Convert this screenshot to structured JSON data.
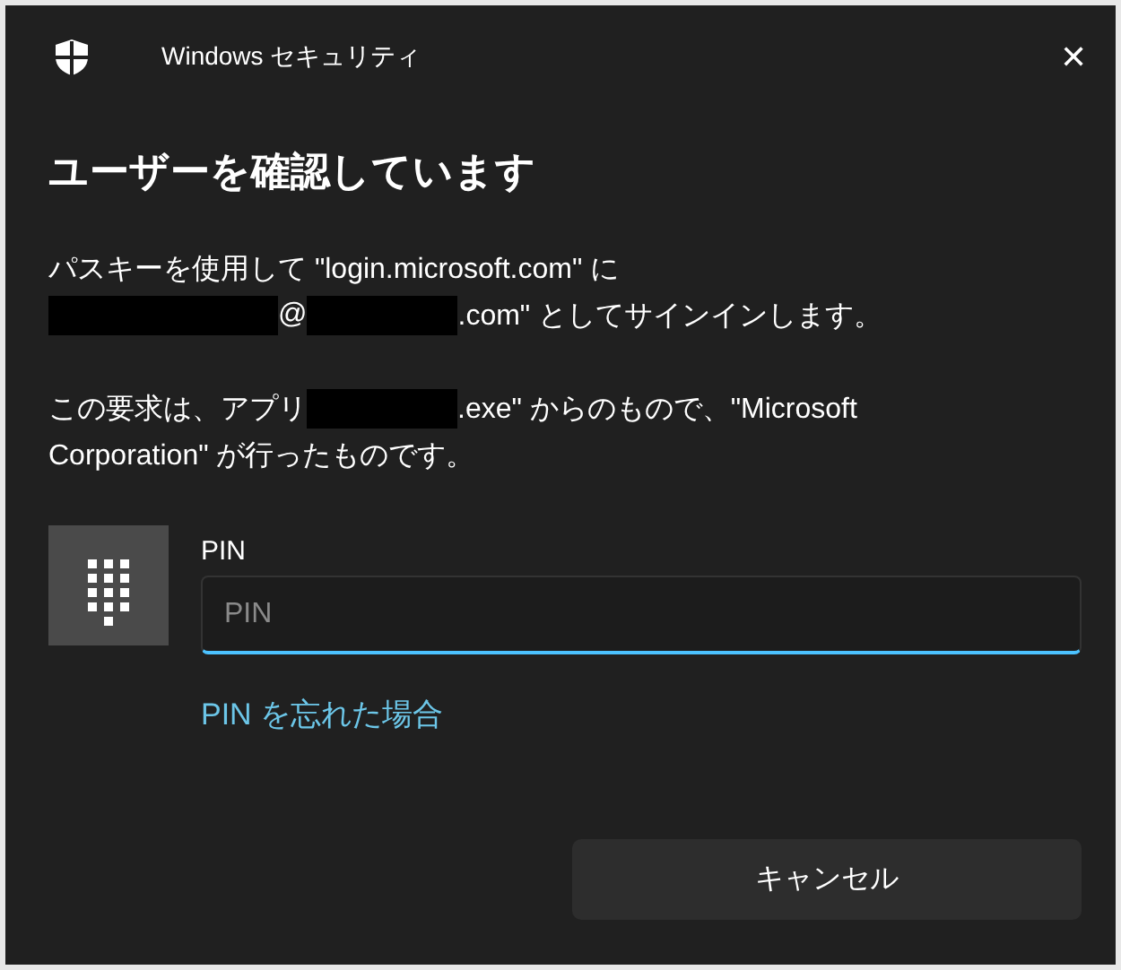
{
  "window": {
    "title": "Windows セキュリティ",
    "close": "✕"
  },
  "heading": "ユーザーを確認しています",
  "messages": [
    {
      "lines": [
        [
          {
            "kind": "text",
            "text": "パスキーを使用して \"login.microsoft.com\" に"
          }
        ],
        [
          {
            "kind": "redacted_long"
          },
          {
            "kind": "text",
            "text": "@"
          },
          {
            "kind": "redacted_short"
          },
          {
            "kind": "text",
            "text": ".com\" としてサインインします。"
          }
        ]
      ]
    },
    {
      "lines": [
        [
          {
            "kind": "text",
            "text": "この要求は、アプリ"
          },
          {
            "kind": "redacted_short"
          },
          {
            "kind": "text",
            "text": ".exe\" からのもので、\"Microsoft"
          }
        ],
        [
          {
            "kind": "text",
            "text": "Corporation\" が行ったものです。"
          }
        ]
      ]
    }
  ],
  "pin": {
    "label": "PIN",
    "placeholder": "PIN",
    "focused": true
  },
  "forgot_link": "PIN を忘れた場合",
  "buttons": [
    {
      "label": "キャンセル"
    }
  ]
}
